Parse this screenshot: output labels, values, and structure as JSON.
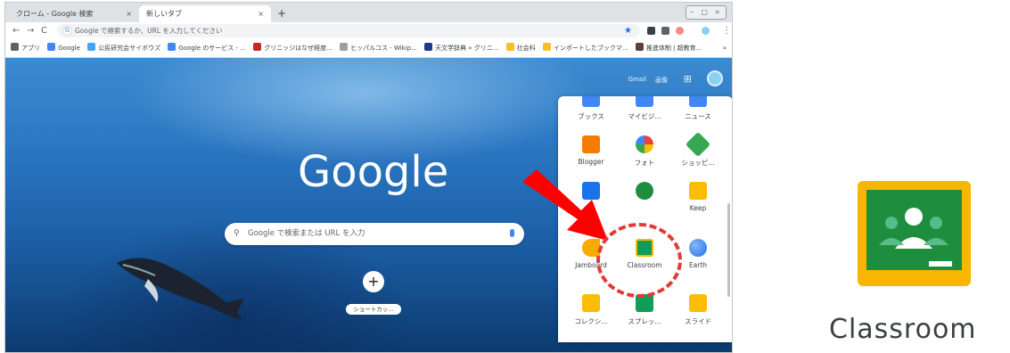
{
  "browser": {
    "tabs": [
      {
        "label": "クローム - Google 検索",
        "close": "×"
      },
      {
        "label": "新しいタブ",
        "close": "×"
      }
    ],
    "new_tab": "+",
    "window_controls": "– ▢ ⌗",
    "omnibox_placeholder": "Google で検索するか、URL を入力してください",
    "nav": {
      "back": "←",
      "forward": "→",
      "reload": "C"
    },
    "more_menu": "⋮",
    "bookmarks": [
      {
        "label": "アプリ",
        "color": "#5f6368"
      },
      {
        "label": "Google",
        "color": "#4285f4"
      },
      {
        "label": "公民研究会サイボウズ",
        "color": "#42a5f5"
      },
      {
        "label": "Google のサービス - ...",
        "color": "#4285f4"
      },
      {
        "label": "グリニッジはなぜ経度...",
        "color": "#c62828"
      },
      {
        "label": "ヒッパルコス - Wikip...",
        "color": "#9e9e9e"
      },
      {
        "label": "天文学辞典 » グリニ...",
        "color": "#1e3a8a"
      },
      {
        "label": "社会科",
        "color": "#f6c026"
      },
      {
        "label": "インポートしたブックマ...",
        "color": "#f6c026"
      },
      {
        "label": "推進体制 | 超教育...",
        "color": "#5d4037"
      }
    ],
    "bookmarks_more": "»"
  },
  "ntp": {
    "gmail": "Gmail",
    "images": "画像",
    "apps_grid": "⊞",
    "logo": "Google",
    "search_placeholder": "Google で検索または URL を入力",
    "add_shortcut": "+",
    "shortcut_label": "ショートカッ..."
  },
  "apps_panel": {
    "items": [
      {
        "label": "ブックス",
        "color": "#4285f4"
      },
      {
        "label": "マイビジ...",
        "color": "#4285f4"
      },
      {
        "label": "ニュース",
        "color": "#4285f4"
      },
      {
        "label": "Blogger",
        "color": "#f57c00"
      },
      {
        "label": "フォト",
        "color": "#fbbc04"
      },
      {
        "label": "ショッピ...",
        "color": "#34a853"
      },
      {
        "label": "",
        "color": "#1a73e8"
      },
      {
        "label": "",
        "color": "#1e8e3e"
      },
      {
        "label": "Keep",
        "color": "#fbbc04"
      },
      {
        "label": "Jamboard",
        "color": "#f9ab00"
      },
      {
        "label": "Classroom",
        "color": "#0f9d58"
      },
      {
        "label": "Earth",
        "color": "#4285f4"
      },
      {
        "label": "コレクシ...",
        "color": "#fbbc04"
      },
      {
        "label": "スプレッ...",
        "color": "#0f9d58"
      },
      {
        "label": "スライド",
        "color": "#fbbc04"
      }
    ]
  },
  "callout": {
    "label": "Classroom",
    "colors": {
      "frame": "#f9b600",
      "board": "#1e8e3e",
      "arrow": "#ff0000",
      "circle": "#e53935"
    }
  }
}
